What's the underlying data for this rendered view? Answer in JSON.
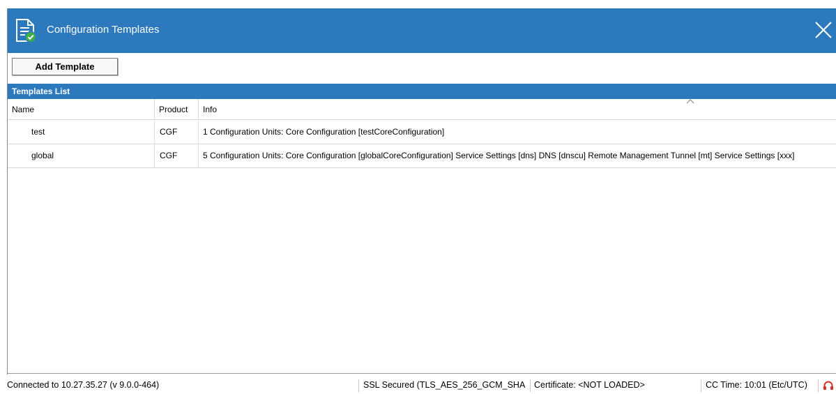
{
  "window": {
    "title": "Configuration Templates",
    "toolbar": {
      "add_template_label": "Add Template"
    },
    "panel": {
      "title": "Templates List",
      "columns": [
        "Name",
        "Product",
        "Info"
      ],
      "rows": [
        {
          "name": "test",
          "product": "CGF",
          "info": "1 Configuration Units: Core Configuration [testCoreConfiguration]"
        },
        {
          "name": "global",
          "product": "CGF",
          "info": "5 Configuration Units: Core Configuration [globalCoreConfiguration] Service Settings [dns] DNS [dnscu] Remote Management Tunnel [mt] Service Settings [xxx]"
        }
      ]
    }
  },
  "statusbar": {
    "connection": "Connected to 10.27.35.27 (v 9.0.0-464)",
    "ssl": "SSL Secured (TLS_AES_256_GCM_SHA",
    "certificate": "Certificate: <NOT LOADED>",
    "cc_time": "CC Time: 10:01 (Etc/UTC)"
  },
  "colors": {
    "titlebar": "#2d79bd",
    "panel_header": "#2d79bd",
    "icon_green": "#3fae49",
    "status_red": "#d9302b"
  },
  "icons": {
    "title": "document-check-icon",
    "close": "close-icon",
    "sort": "sort-indicator-icon",
    "status": "support-headset-icon"
  }
}
